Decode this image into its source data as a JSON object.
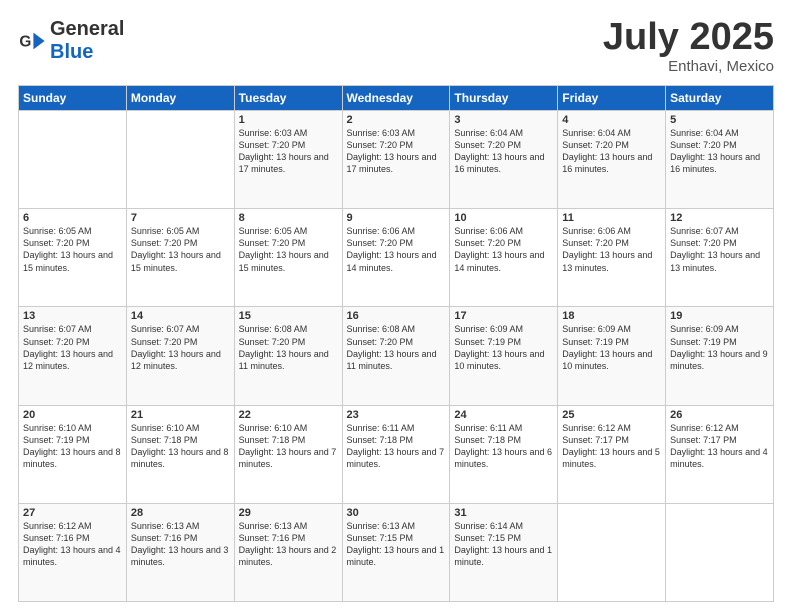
{
  "header": {
    "logo_general": "General",
    "logo_blue": "Blue",
    "month_title": "July 2025",
    "location": "Enthavi, Mexico"
  },
  "days_of_week": [
    "Sunday",
    "Monday",
    "Tuesday",
    "Wednesday",
    "Thursday",
    "Friday",
    "Saturday"
  ],
  "weeks": [
    [
      {
        "day": "",
        "info": ""
      },
      {
        "day": "",
        "info": ""
      },
      {
        "day": "1",
        "info": "Sunrise: 6:03 AM\nSunset: 7:20 PM\nDaylight: 13 hours and 17 minutes."
      },
      {
        "day": "2",
        "info": "Sunrise: 6:03 AM\nSunset: 7:20 PM\nDaylight: 13 hours and 17 minutes."
      },
      {
        "day": "3",
        "info": "Sunrise: 6:04 AM\nSunset: 7:20 PM\nDaylight: 13 hours and 16 minutes."
      },
      {
        "day": "4",
        "info": "Sunrise: 6:04 AM\nSunset: 7:20 PM\nDaylight: 13 hours and 16 minutes."
      },
      {
        "day": "5",
        "info": "Sunrise: 6:04 AM\nSunset: 7:20 PM\nDaylight: 13 hours and 16 minutes."
      }
    ],
    [
      {
        "day": "6",
        "info": "Sunrise: 6:05 AM\nSunset: 7:20 PM\nDaylight: 13 hours and 15 minutes."
      },
      {
        "day": "7",
        "info": "Sunrise: 6:05 AM\nSunset: 7:20 PM\nDaylight: 13 hours and 15 minutes."
      },
      {
        "day": "8",
        "info": "Sunrise: 6:05 AM\nSunset: 7:20 PM\nDaylight: 13 hours and 15 minutes."
      },
      {
        "day": "9",
        "info": "Sunrise: 6:06 AM\nSunset: 7:20 PM\nDaylight: 13 hours and 14 minutes."
      },
      {
        "day": "10",
        "info": "Sunrise: 6:06 AM\nSunset: 7:20 PM\nDaylight: 13 hours and 14 minutes."
      },
      {
        "day": "11",
        "info": "Sunrise: 6:06 AM\nSunset: 7:20 PM\nDaylight: 13 hours and 13 minutes."
      },
      {
        "day": "12",
        "info": "Sunrise: 6:07 AM\nSunset: 7:20 PM\nDaylight: 13 hours and 13 minutes."
      }
    ],
    [
      {
        "day": "13",
        "info": "Sunrise: 6:07 AM\nSunset: 7:20 PM\nDaylight: 13 hours and 12 minutes."
      },
      {
        "day": "14",
        "info": "Sunrise: 6:07 AM\nSunset: 7:20 PM\nDaylight: 13 hours and 12 minutes."
      },
      {
        "day": "15",
        "info": "Sunrise: 6:08 AM\nSunset: 7:20 PM\nDaylight: 13 hours and 11 minutes."
      },
      {
        "day": "16",
        "info": "Sunrise: 6:08 AM\nSunset: 7:20 PM\nDaylight: 13 hours and 11 minutes."
      },
      {
        "day": "17",
        "info": "Sunrise: 6:09 AM\nSunset: 7:19 PM\nDaylight: 13 hours and 10 minutes."
      },
      {
        "day": "18",
        "info": "Sunrise: 6:09 AM\nSunset: 7:19 PM\nDaylight: 13 hours and 10 minutes."
      },
      {
        "day": "19",
        "info": "Sunrise: 6:09 AM\nSunset: 7:19 PM\nDaylight: 13 hours and 9 minutes."
      }
    ],
    [
      {
        "day": "20",
        "info": "Sunrise: 6:10 AM\nSunset: 7:19 PM\nDaylight: 13 hours and 8 minutes."
      },
      {
        "day": "21",
        "info": "Sunrise: 6:10 AM\nSunset: 7:18 PM\nDaylight: 13 hours and 8 minutes."
      },
      {
        "day": "22",
        "info": "Sunrise: 6:10 AM\nSunset: 7:18 PM\nDaylight: 13 hours and 7 minutes."
      },
      {
        "day": "23",
        "info": "Sunrise: 6:11 AM\nSunset: 7:18 PM\nDaylight: 13 hours and 7 minutes."
      },
      {
        "day": "24",
        "info": "Sunrise: 6:11 AM\nSunset: 7:18 PM\nDaylight: 13 hours and 6 minutes."
      },
      {
        "day": "25",
        "info": "Sunrise: 6:12 AM\nSunset: 7:17 PM\nDaylight: 13 hours and 5 minutes."
      },
      {
        "day": "26",
        "info": "Sunrise: 6:12 AM\nSunset: 7:17 PM\nDaylight: 13 hours and 4 minutes."
      }
    ],
    [
      {
        "day": "27",
        "info": "Sunrise: 6:12 AM\nSunset: 7:16 PM\nDaylight: 13 hours and 4 minutes."
      },
      {
        "day": "28",
        "info": "Sunrise: 6:13 AM\nSunset: 7:16 PM\nDaylight: 13 hours and 3 minutes."
      },
      {
        "day": "29",
        "info": "Sunrise: 6:13 AM\nSunset: 7:16 PM\nDaylight: 13 hours and 2 minutes."
      },
      {
        "day": "30",
        "info": "Sunrise: 6:13 AM\nSunset: 7:15 PM\nDaylight: 13 hours and 1 minute."
      },
      {
        "day": "31",
        "info": "Sunrise: 6:14 AM\nSunset: 7:15 PM\nDaylight: 13 hours and 1 minute."
      },
      {
        "day": "",
        "info": ""
      },
      {
        "day": "",
        "info": ""
      }
    ]
  ]
}
